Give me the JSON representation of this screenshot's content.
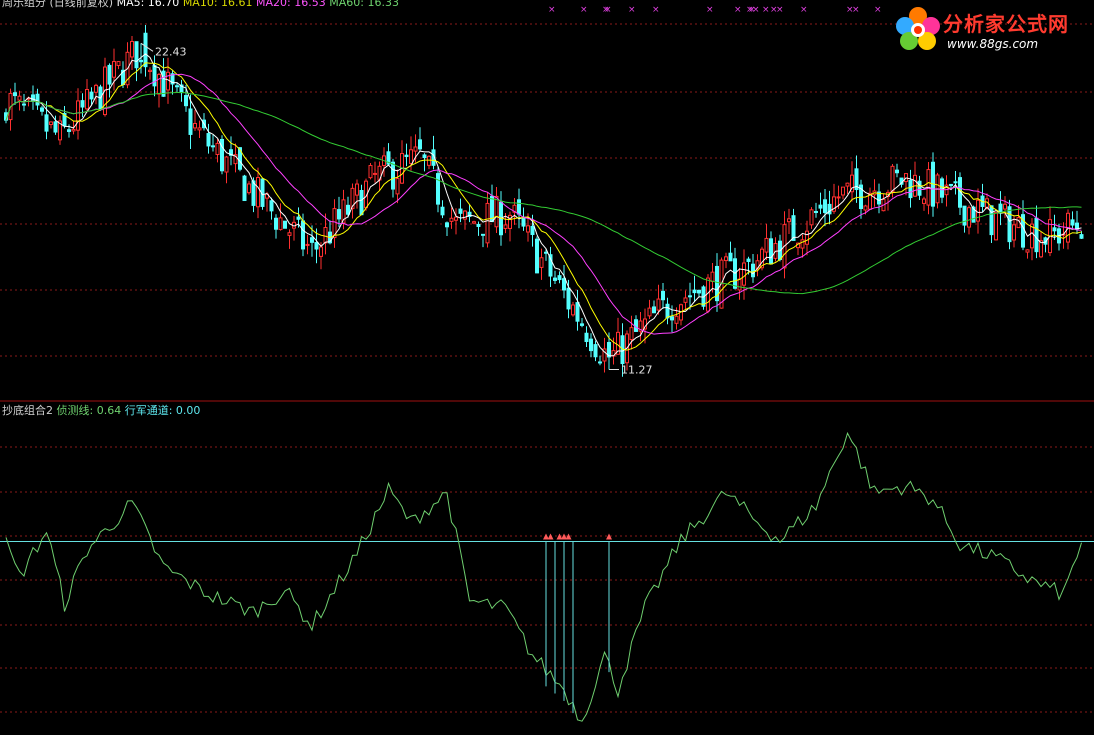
{
  "upper_header": {
    "title": "周乐组分 (日线前复权)",
    "ma5": "MA5: 16.70",
    "ma10": "MA10: 16.61",
    "ma20": "MA20: 16.53",
    "ma60": "MA60: 16.33"
  },
  "lower_header": {
    "name": "抄底组合2",
    "line1": "侦测线: 0.64",
    "line2": "行军通道: 0.00"
  },
  "logo": {
    "title": "分析家公式网",
    "url": "www.88gs.com"
  },
  "colors": {
    "up": "#ff3030",
    "down": "#54ffff",
    "ma5": "#ffffff",
    "ma10": "#ffff00",
    "ma20": "#ff40ff",
    "ma60": "#33cc33",
    "detect_line": "#6fcf6f",
    "channel": "#66e0e0",
    "grid": "#8a1a1a",
    "divider": "#a01010"
  },
  "chart_data": [
    {
      "type": "candlestick",
      "title": "周乐组分 (日线前复权)",
      "annotations": [
        {
          "label": "22.43",
          "kind": "high",
          "bar": 30
        },
        {
          "label": "11.27",
          "kind": "low",
          "bar": 134
        }
      ],
      "ylim": [
        10.5,
        23.5
      ],
      "grid": "horizontal dashed",
      "price_path_keypoints": [
        {
          "bar": 0,
          "price": 20.5
        },
        {
          "bar": 12,
          "price": 19.2
        },
        {
          "bar": 30,
          "price": 22.3
        },
        {
          "bar": 42,
          "price": 19.5
        },
        {
          "bar": 55,
          "price": 17.3
        },
        {
          "bar": 68,
          "price": 15.3
        },
        {
          "bar": 82,
          "price": 17.8
        },
        {
          "bar": 92,
          "price": 18.5
        },
        {
          "bar": 100,
          "price": 16.2
        },
        {
          "bar": 112,
          "price": 16.6
        },
        {
          "bar": 125,
          "price": 13.6
        },
        {
          "bar": 134,
          "price": 11.6
        },
        {
          "bar": 148,
          "price": 13.6
        },
        {
          "bar": 165,
          "price": 14.8
        },
        {
          "bar": 185,
          "price": 17.2
        },
        {
          "bar": 200,
          "price": 17.8
        },
        {
          "bar": 220,
          "price": 16.4
        },
        {
          "bar": 232,
          "price": 15.8
        },
        {
          "bar": 239,
          "price": 16.3
        }
      ],
      "series": [
        {
          "name": "MA5: 16.70"
        },
        {
          "name": "MA10: 16.61"
        },
        {
          "name": "MA20: 16.53"
        },
        {
          "name": "MA60: 16.33"
        }
      ]
    },
    {
      "type": "line",
      "title": "抄底组合2",
      "series": [
        {
          "name": "侦测线: 0.64",
          "values_at_keypoints": [
            {
              "bar": 0,
              "v": 0.62
            },
            {
              "bar": 3,
              "v": 0.38
            },
            {
              "bar": 9,
              "v": 0.72
            },
            {
              "bar": 13,
              "v": 0.18
            },
            {
              "bar": 18,
              "v": 0.58
            },
            {
              "bar": 28,
              "v": 0.92
            },
            {
              "bar": 35,
              "v": 0.45
            },
            {
              "bar": 45,
              "v": 0.25
            },
            {
              "bar": 55,
              "v": 0.12
            },
            {
              "bar": 62,
              "v": 0.28
            },
            {
              "bar": 68,
              "v": 0.02
            },
            {
              "bar": 78,
              "v": 0.55
            },
            {
              "bar": 85,
              "v": 1.02
            },
            {
              "bar": 90,
              "v": 0.78
            },
            {
              "bar": 98,
              "v": 1.0
            },
            {
              "bar": 103,
              "v": 0.2
            },
            {
              "bar": 111,
              "v": 0.15
            },
            {
              "bar": 117,
              "v": -0.2
            },
            {
              "bar": 124,
              "v": -0.45
            },
            {
              "bar": 128,
              "v": -0.68
            },
            {
              "bar": 133,
              "v": -0.2
            },
            {
              "bar": 136,
              "v": -0.45
            },
            {
              "bar": 142,
              "v": 0.15
            },
            {
              "bar": 150,
              "v": 0.65
            },
            {
              "bar": 160,
              "v": 1.0
            },
            {
              "bar": 167,
              "v": 0.78
            },
            {
              "bar": 172,
              "v": 0.65
            },
            {
              "bar": 180,
              "v": 0.9
            },
            {
              "bar": 187,
              "v": 1.45
            },
            {
              "bar": 193,
              "v": 1.0
            },
            {
              "bar": 200,
              "v": 1.05
            },
            {
              "bar": 206,
              "v": 0.95
            },
            {
              "bar": 212,
              "v": 0.62
            },
            {
              "bar": 220,
              "v": 0.52
            },
            {
              "bar": 228,
              "v": 0.35
            },
            {
              "bar": 235,
              "v": 0.25
            },
            {
              "bar": 239,
              "v": 0.64
            }
          ]
        },
        {
          "name": "行军通道: 0.00"
        }
      ],
      "channel_level": 0.64,
      "signals": [
        {
          "bar": 120,
          "kind": "arrow"
        },
        {
          "bar": 121,
          "kind": "arrow"
        },
        {
          "bar": 123,
          "kind": "arrow"
        },
        {
          "bar": 124,
          "kind": "arrow"
        },
        {
          "bar": 125,
          "kind": "arrow"
        },
        {
          "bar": 134,
          "kind": "arrow"
        }
      ],
      "ylim": [
        -0.75,
        1.55
      ],
      "grid": "horizontal dashed"
    }
  ]
}
